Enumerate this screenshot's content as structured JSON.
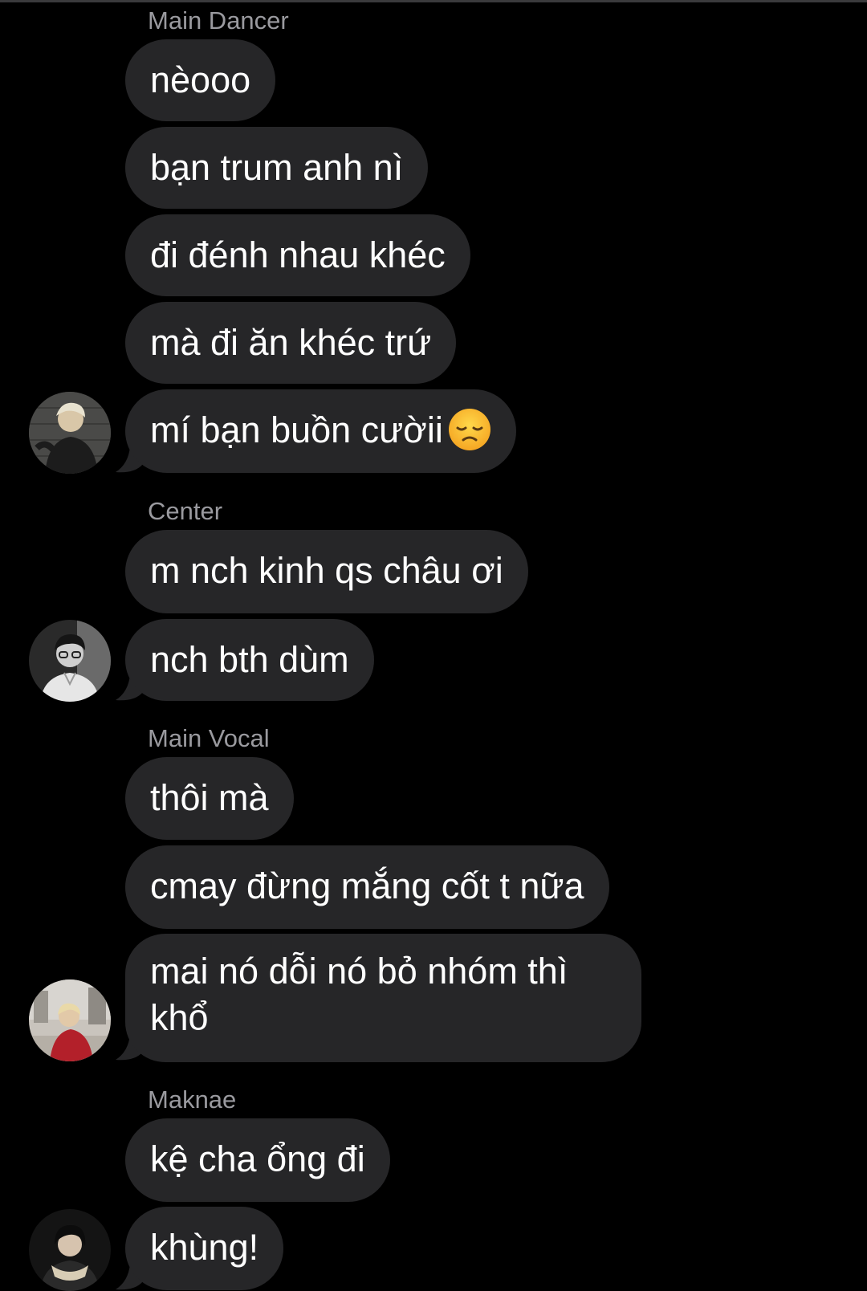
{
  "groups": [
    {
      "sender": "Main Dancer",
      "messages": [
        "nèooo",
        "bạn trum anh nì",
        "đi đénh nhau khéc",
        "mà đi ăn khéc trứ",
        "mí bạn buồn cườii"
      ],
      "emoji": "disappointed-face-emoji"
    },
    {
      "sender": "Center",
      "messages": [
        "m nch kinh qs châu ơi",
        "nch bth dùm"
      ]
    },
    {
      "sender": "Main Vocal",
      "messages": [
        "thôi mà",
        "cmay đừng mắng cốt t nữa",
        "mai nó dỗi nó bỏ nhóm thì khổ"
      ]
    },
    {
      "sender": "Maknae",
      "messages": [
        "kệ cha ổng đi",
        "khùng!"
      ]
    }
  ],
  "colors": {
    "background": "#000000",
    "bubble": "#262628",
    "sender_label": "#9a9a9f",
    "message_text": "#ffffff"
  }
}
